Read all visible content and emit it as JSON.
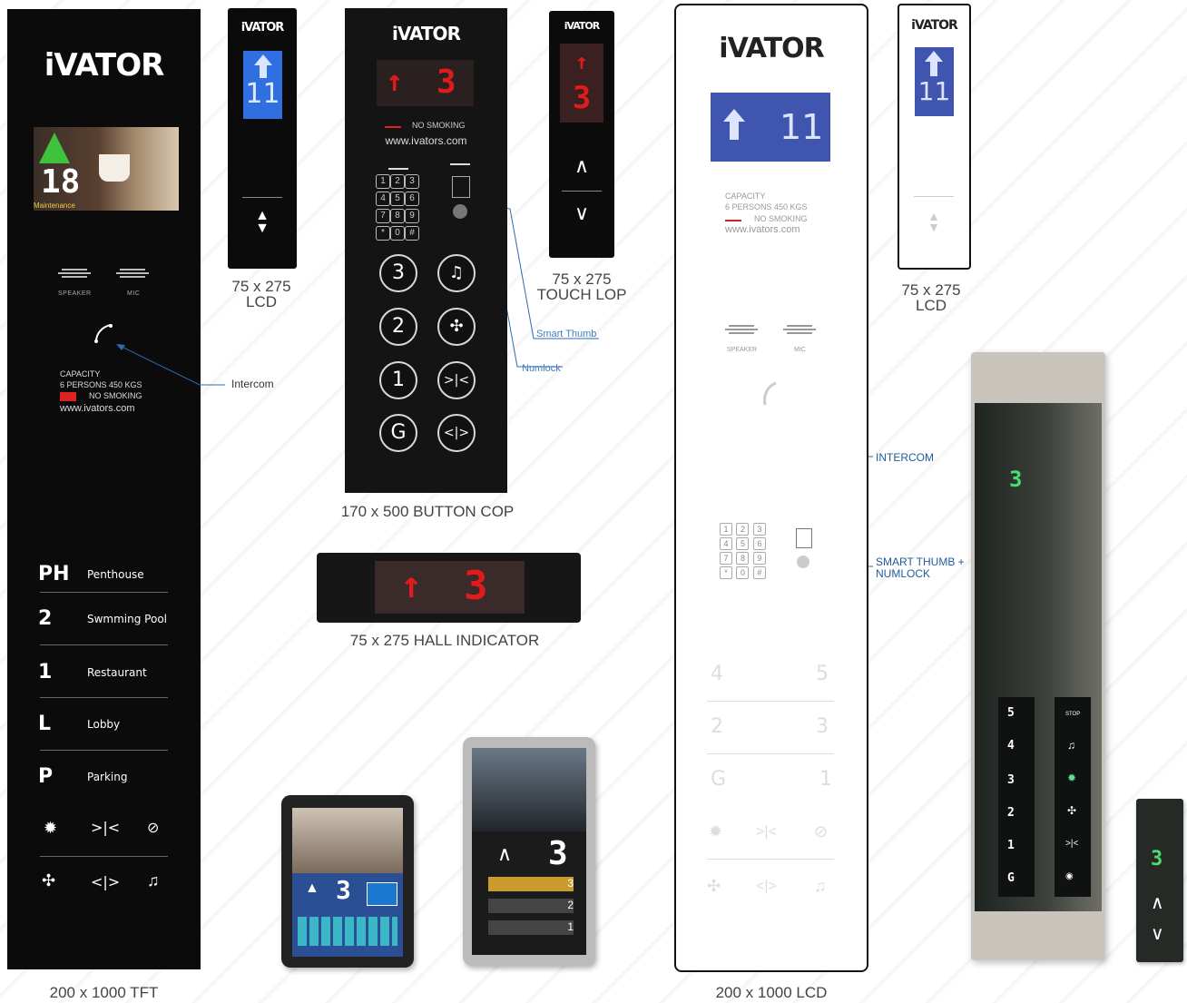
{
  "brand": "iVATOR",
  "tft_panel": {
    "display_floor": "18",
    "display_status": "Maintenance",
    "speaker_label": "SPEAKER",
    "mic_label": "MIC",
    "capacity_title": "CAPACITY",
    "capacity_text": "6 PERSONS 450 KGS",
    "no_smoking": "NO SMOKING",
    "website": "www.ivators.com",
    "floors": [
      {
        "num": "PH",
        "label": "Penthouse"
      },
      {
        "num": "2",
        "label": "Swmming Pool"
      },
      {
        "num": "1",
        "label": "Restaurant"
      },
      {
        "num": "L",
        "label": "Lobby"
      },
      {
        "num": "P",
        "label": "Parking"
      }
    ],
    "caption": "200 x 1000 TFT"
  },
  "callouts": {
    "intercom": "Intercom",
    "smart_thumb": "Smart Thumb",
    "numlock": "Numlock",
    "intercom_caps": "INTERCOM",
    "smart_thumb_numlock_line1": "SMART THUMB +",
    "smart_thumb_numlock_line2": "NUMLOCK"
  },
  "lcd_small": {
    "floor": "11",
    "caption_line1": "75 x 275",
    "caption_line2": "LCD"
  },
  "cop": {
    "display_floor": "3",
    "no_smoking": "NO SMOKING",
    "website": "www.ivators.com",
    "keypad": [
      "1",
      "2",
      "3",
      "4",
      "5",
      "6",
      "7",
      "8",
      "9",
      "*",
      "0",
      "#"
    ],
    "buttons": [
      "3",
      "2",
      "1",
      "G"
    ],
    "caption": "170 x 500 BUTTON COP"
  },
  "touch_lop": {
    "floor": "3",
    "caption_line1": "75 x 275",
    "caption_line2": "TOUCH LOP"
  },
  "hall": {
    "floor": "3",
    "caption": "75 x 275 HALL INDICATOR"
  },
  "lcd_panel": {
    "display_floor": "11",
    "capacity_title": "CAPACITY",
    "capacity_text": "6 PERSONS 450 KGS",
    "no_smoking": "NO SMOKING",
    "website": "www.ivators.com",
    "speaker_label": "SPEAKER",
    "mic_label": "MIC",
    "keypad": [
      "1",
      "2",
      "3",
      "4",
      "5",
      "6",
      "7",
      "8",
      "9",
      "*",
      "0",
      "#"
    ],
    "buttons": [
      [
        "4",
        "5"
      ],
      [
        "2",
        "3"
      ],
      [
        "G",
        "1"
      ]
    ],
    "caption": "200 x 1000 LCD"
  },
  "lcd_small_2": {
    "floor": "11",
    "caption_line1": "75 x 275",
    "caption_line2": "LCD"
  },
  "tablet_1": {
    "floor": "3"
  },
  "tablet_2": {
    "floor": "3",
    "rows": [
      "3",
      "2",
      "1"
    ]
  },
  "photo_panel": {
    "display_floor": "3",
    "floors": [
      "5",
      "4",
      "3",
      "2",
      "1",
      "G"
    ],
    "stop_label": "STOP"
  },
  "photo_small": {
    "floor": "3"
  }
}
